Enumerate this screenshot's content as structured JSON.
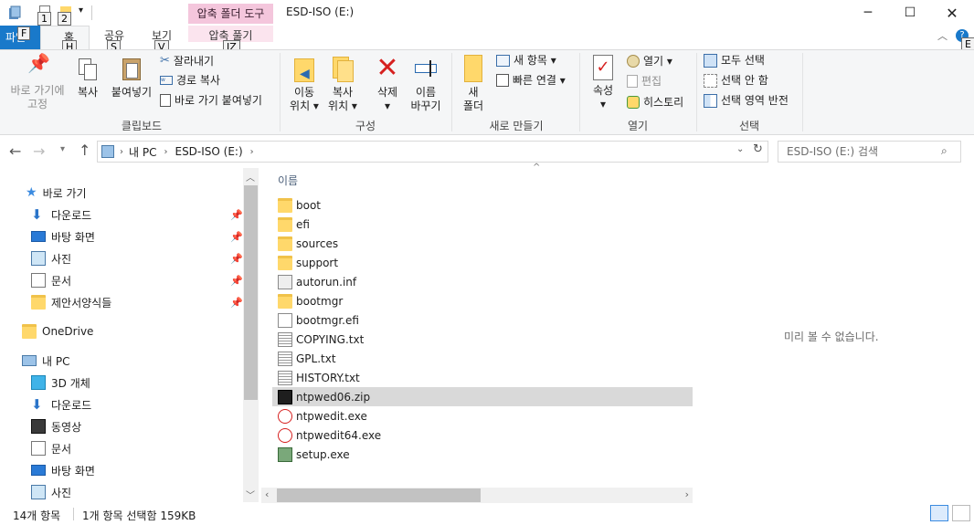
{
  "window": {
    "title": "ESD-ISO (E:)",
    "context_tab": "압축 폴더 도구",
    "context_subtab": "압축 풀기"
  },
  "keytips": {
    "qat1": "1",
    "qat2": "2",
    "file": "F",
    "home": "H",
    "share": "S",
    "view": "V",
    "extract": "JZ",
    "help": "E"
  },
  "tabs": {
    "file": "파일",
    "home": "홈",
    "share": "공유",
    "view": "보기",
    "extract": "압축 풀기"
  },
  "ribbon": {
    "clipboard": {
      "label": "클립보드",
      "pin": "바로 가기에\n고정",
      "copy": "복사",
      "paste": "붙여넣기",
      "cut": "잘라내기",
      "copy_path": "경로 복사",
      "paste_shortcut": "바로 가기 붙여넣기"
    },
    "organize": {
      "label": "구성",
      "move_to": "이동\n위치 ▾",
      "copy_to": "복사\n위치 ▾",
      "delete": "삭제\n▾",
      "rename": "이름\n바꾸기"
    },
    "new": {
      "label": "새로 만들기",
      "new_folder": "새\n폴더",
      "new_item": "새 항목 ▾",
      "easy_access": "빠른 연결 ▾"
    },
    "open": {
      "label": "열기",
      "properties": "속성\n▾",
      "open": "열기 ▾",
      "edit": "편집",
      "history": "히스토리"
    },
    "select": {
      "label": "선택",
      "select_all": "모두 선택",
      "select_none": "선택 안 함",
      "invert": "선택 영역 반전"
    }
  },
  "address": {
    "crumb_pc": "내 PC",
    "crumb_drive": "ESD-ISO (E:)",
    "search_placeholder": "ESD-ISO (E:) 검색"
  },
  "nav": {
    "quick_access": "바로 가기",
    "qa_items": [
      "다운로드",
      "바탕 화면",
      "사진",
      "문서",
      "제안서양식들"
    ],
    "onedrive": "OneDrive",
    "this_pc": "내 PC",
    "pc_items": [
      "3D 개체",
      "다운로드",
      "동영상",
      "문서",
      "바탕 화면",
      "사진"
    ]
  },
  "filelist": {
    "header_name": "이름",
    "files": [
      "boot",
      "efi",
      "sources",
      "support",
      "autorun.inf",
      "bootmgr",
      "bootmgr.efi",
      "COPYING.txt",
      "GPL.txt",
      "HISTORY.txt",
      "ntpwed06.zip",
      "ntpwedit.exe",
      "ntpwedit64.exe",
      "setup.exe"
    ],
    "preview_text": "미리 볼 수 없습니다."
  },
  "status": {
    "count": "14개 항목",
    "selected": "1개 항목 선택함 159KB"
  },
  "colors": {
    "accent": "#1979ca",
    "context": "#f4c6dc",
    "selected_row": "#d9d9d9"
  }
}
